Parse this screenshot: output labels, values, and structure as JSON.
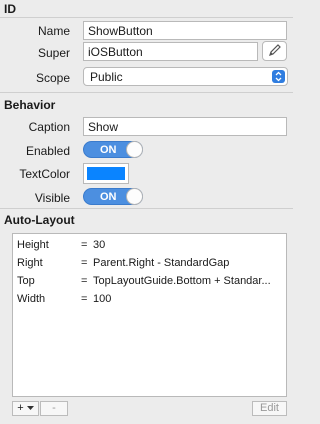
{
  "sections": {
    "id": "ID",
    "behavior": "Behavior",
    "autolayout": "Auto-Layout"
  },
  "id": {
    "name_label": "Name",
    "name_value": "ShowButton",
    "super_label": "Super",
    "super_value": "iOSButton",
    "scope_label": "Scope",
    "scope_value": "Public"
  },
  "behavior": {
    "caption_label": "Caption",
    "caption_value": "Show",
    "enabled_label": "Enabled",
    "enabled_value": "ON",
    "textcolor_label": "TextColor",
    "textcolor_hex": "#0a84ff",
    "visible_label": "Visible",
    "visible_value": "ON"
  },
  "autolayout": {
    "rows": [
      {
        "key": "Height",
        "eq": "=",
        "value": "30"
      },
      {
        "key": "Right",
        "eq": "=",
        "value": "Parent.Right - StandardGap"
      },
      {
        "key": "Top",
        "eq": "=",
        "value": "TopLayoutGuide.Bottom + Standar..."
      },
      {
        "key": "Width",
        "eq": "=",
        "value": "100"
      }
    ],
    "add_label": "+",
    "remove_label": "-",
    "edit_label": "Edit"
  },
  "icons": {
    "pencil": "pencil-icon",
    "chevron": "chevron-updown-icon",
    "add_dropdown": "chevron-down-icon"
  }
}
